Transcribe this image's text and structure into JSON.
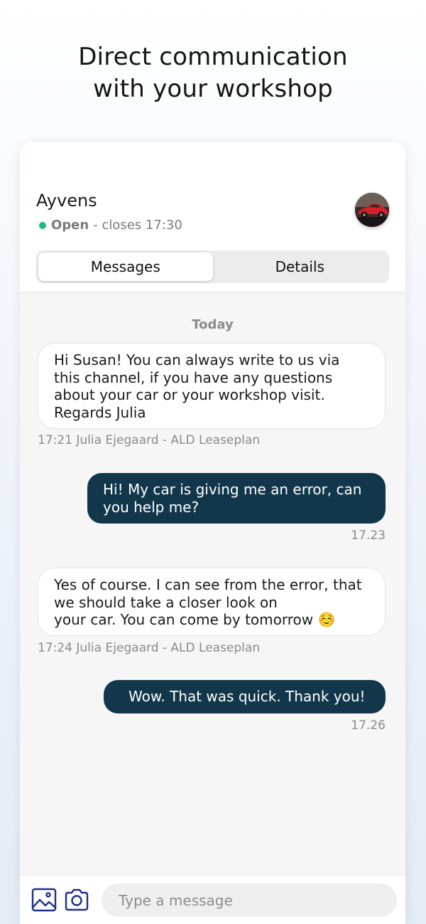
{
  "hero": {
    "line1": "Direct communication",
    "line2": "with your workshop"
  },
  "chat_header": {
    "name": "Ayvens",
    "status": "Open",
    "hours": "- closes 17:30",
    "avatar_icon": "car-photo-avatar"
  },
  "tabs": [
    {
      "label": "Messages",
      "active": true
    },
    {
      "label": "Details",
      "active": false
    }
  ],
  "day_label": "Today",
  "messages": [
    {
      "direction": "incoming",
      "lines": [
        "Hi Susan! You can always write to us via",
        "this channel, if you have any questions",
        "about your car or your workshop visit.",
        "Regards Julia"
      ],
      "meta": "17:21 Julia Ejegaard - ALD Leaseplan"
    },
    {
      "direction": "outgoing",
      "lines": [
        "Hi! My car is giving me an error, can",
        "you help me?"
      ],
      "meta": "17.23"
    },
    {
      "direction": "incoming",
      "lines": [
        "Yes of course. I can see from the error, that",
        "we should take a closer look on",
        "your car. You can come by tomorrow ☺️"
      ],
      "meta": "17:24 Julia Ejegaard - ALD Leaseplan"
    },
    {
      "direction": "outgoing",
      "lines": [
        "Wow. That was quick. Thank you!"
      ],
      "meta": "17.26"
    }
  ],
  "composer": {
    "placeholder": "Type a message",
    "image_icon": "image-icon",
    "camera_icon": "camera-icon"
  },
  "colors": {
    "accent": "#12374b",
    "status_open": "#1cba7c",
    "icon": "#1f2f8a"
  }
}
